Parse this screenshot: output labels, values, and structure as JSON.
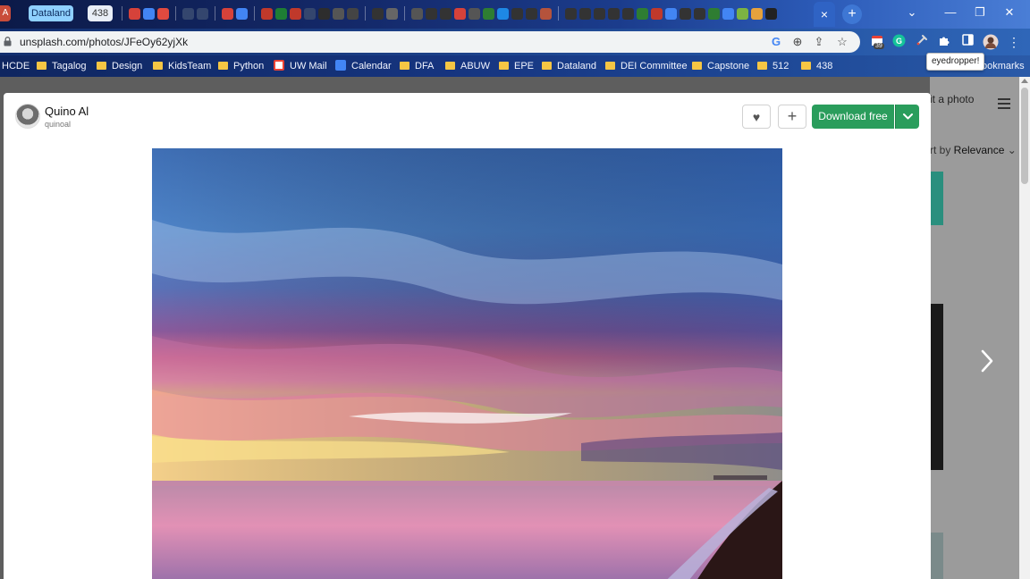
{
  "tabs": {
    "left_stub": "A",
    "pinned": [
      {
        "label": "Dataland"
      },
      {
        "label": "438"
      }
    ],
    "active_close": "×",
    "new_tab": "+"
  },
  "window_controls": {
    "menu": "⌄",
    "minimize": "—",
    "maximize": "❐",
    "close": "✕"
  },
  "address_bar": {
    "url": "unsplash.com/photos/JFeOy62yjXk"
  },
  "extensions": {
    "badge": "39",
    "tooltip": "eyedropper!"
  },
  "bookmarks": [
    {
      "label": "HCDE",
      "type": "text"
    },
    {
      "label": "Tagalog",
      "type": "folder"
    },
    {
      "label": "Design",
      "type": "folder"
    },
    {
      "label": "KidsTeam",
      "type": "folder"
    },
    {
      "label": "Python",
      "type": "folder"
    },
    {
      "label": "UW Mail",
      "type": "gmail"
    },
    {
      "label": "Calendar",
      "type": "calendar"
    },
    {
      "label": "DFA",
      "type": "folder"
    },
    {
      "label": "ABUW",
      "type": "folder"
    },
    {
      "label": "EPE",
      "type": "folder"
    },
    {
      "label": "Dataland",
      "type": "folder"
    },
    {
      "label": "DEI Committee",
      "type": "folder"
    },
    {
      "label": "Capstone",
      "type": "folder"
    },
    {
      "label": "512",
      "type": "folder"
    },
    {
      "label": "438",
      "type": "folder"
    },
    {
      "label": "ookmarks",
      "type": "text"
    }
  ],
  "background_page": {
    "upload_label": "it a photo",
    "sort_prefix": "rt by ",
    "sort_value": "Relevance"
  },
  "modal": {
    "author": {
      "name": "Quino Al",
      "handle": "quinoal"
    },
    "download_label": "Download free",
    "like_icon": "♥",
    "collect_icon": "+"
  },
  "colors": {
    "download_green": "#2a9d5c",
    "chrome_frame": "#1c3f86"
  }
}
